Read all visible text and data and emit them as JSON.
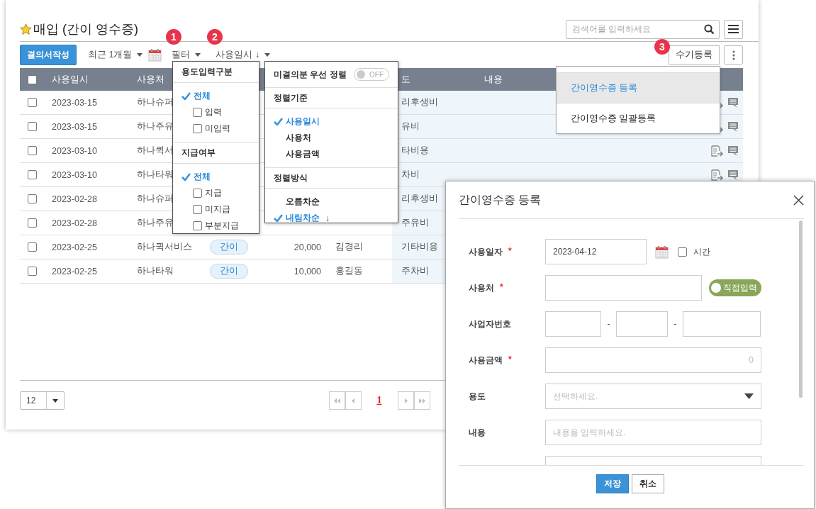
{
  "page": {
    "title": "매입 (간이 영수증)",
    "search_placeholder": "검색어를 입력하세요"
  },
  "toolbar": {
    "create_button": "결의서작성",
    "period": "최근 1개월",
    "filter": "필터",
    "sort": "사용일시 ↓",
    "manual_button": "수기등록"
  },
  "badges": [
    "1",
    "2",
    "3"
  ],
  "table": {
    "select_all": false,
    "columns": [
      {
        "label": "사용일시",
        "kind": "date"
      },
      {
        "label": "사용처",
        "kind": "vendor"
      },
      {
        "label": "도",
        "kind": "purpose"
      },
      {
        "label": "내용",
        "kind": "content"
      }
    ],
    "rows": [
      {
        "checked": false,
        "date": "2023-03-15",
        "vendor": "하나슈퍼",
        "purpose": "리후생비"
      },
      {
        "checked": false,
        "date": "2023-03-15",
        "vendor": "하나주유",
        "purpose": "유비"
      },
      {
        "checked": false,
        "date": "2023-03-10",
        "vendor": "하나퀵서",
        "purpose": "타비용"
      },
      {
        "checked": false,
        "date": "2023-03-10",
        "vendor": "하나타워",
        "purpose": "차비"
      },
      {
        "checked": false,
        "date": "2023-02-28",
        "vendor": "하나슈퍼",
        "purpose": "리후생비"
      },
      {
        "checked": false,
        "date": "2023-02-28",
        "vendor": "하나주유",
        "purpose": "주유비"
      },
      {
        "checked": false,
        "date": "2023-02-25",
        "vendor": "하나퀵서비스",
        "tag": "간이",
        "amount": "20,000",
        "person": "김경리",
        "purpose": "기타비용"
      },
      {
        "checked": false,
        "date": "2023-02-25",
        "vendor": "하나타워",
        "tag": "간이",
        "amount": "10,000",
        "person": "홍길동",
        "purpose": "주차비"
      }
    ]
  },
  "pagination": {
    "page_size": "12",
    "current_page": "1"
  },
  "filter_menu": {
    "groups": [
      {
        "title": "용도입력구분",
        "items": [
          {
            "label": "전체",
            "kind": "all",
            "checked": true
          },
          {
            "label": "입력",
            "kind": "checkbox",
            "checked": false
          },
          {
            "label": "미입력",
            "kind": "checkbox",
            "checked": false
          }
        ]
      },
      {
        "title": "지급여부",
        "items": [
          {
            "label": "전체",
            "kind": "all",
            "checked": true
          },
          {
            "label": "지급",
            "kind": "checkbox",
            "checked": false
          },
          {
            "label": "미지급",
            "kind": "checkbox",
            "checked": false
          },
          {
            "label": "부분지급",
            "kind": "checkbox",
            "checked": false
          }
        ]
      }
    ]
  },
  "sort_menu": {
    "priority_label": "미결의분 우선 정렬",
    "toggle_label": "OFF",
    "toggle_on": false,
    "groups": [
      {
        "title": "정렬기준",
        "items": [
          {
            "label": "사용일시",
            "selected": true
          },
          {
            "label": "사용처",
            "selected": false
          },
          {
            "label": "사용금액",
            "selected": false
          }
        ]
      },
      {
        "title": "정렬방식",
        "items": [
          {
            "label": "오름차순",
            "selected": false
          },
          {
            "label": "내림차순",
            "suffix": "↓",
            "selected": true
          }
        ]
      }
    ]
  },
  "add_menu": {
    "items": [
      {
        "label": "간이영수증 등록",
        "selected": true
      },
      {
        "label": "간이영수증 일괄등록",
        "selected": false
      }
    ]
  },
  "dialog": {
    "title": "간이영수증 등록",
    "save_button": "저장",
    "cancel_button": "취소",
    "fields": [
      {
        "kind": "date",
        "label": "사용일자",
        "required_mark": "*",
        "value": "2023-04-12",
        "option_label": "시간",
        "option_checked": false
      },
      {
        "kind": "toggle_text",
        "label": "사용처",
        "required_mark": "*",
        "toggle_label": "직접입력",
        "toggle_on": true
      },
      {
        "kind": "biz_number",
        "label": "사업자번호",
        "separators": [
          "-",
          "-"
        ]
      },
      {
        "kind": "number",
        "label": "사용금액",
        "required_mark": "*",
        "placeholder": "0"
      },
      {
        "kind": "select",
        "label": "용도",
        "placeholder": "선택하세요."
      },
      {
        "kind": "text",
        "label": "내용",
        "placeholder": "내용을 입력하세요."
      },
      {
        "kind": "blank_select"
      }
    ]
  }
}
